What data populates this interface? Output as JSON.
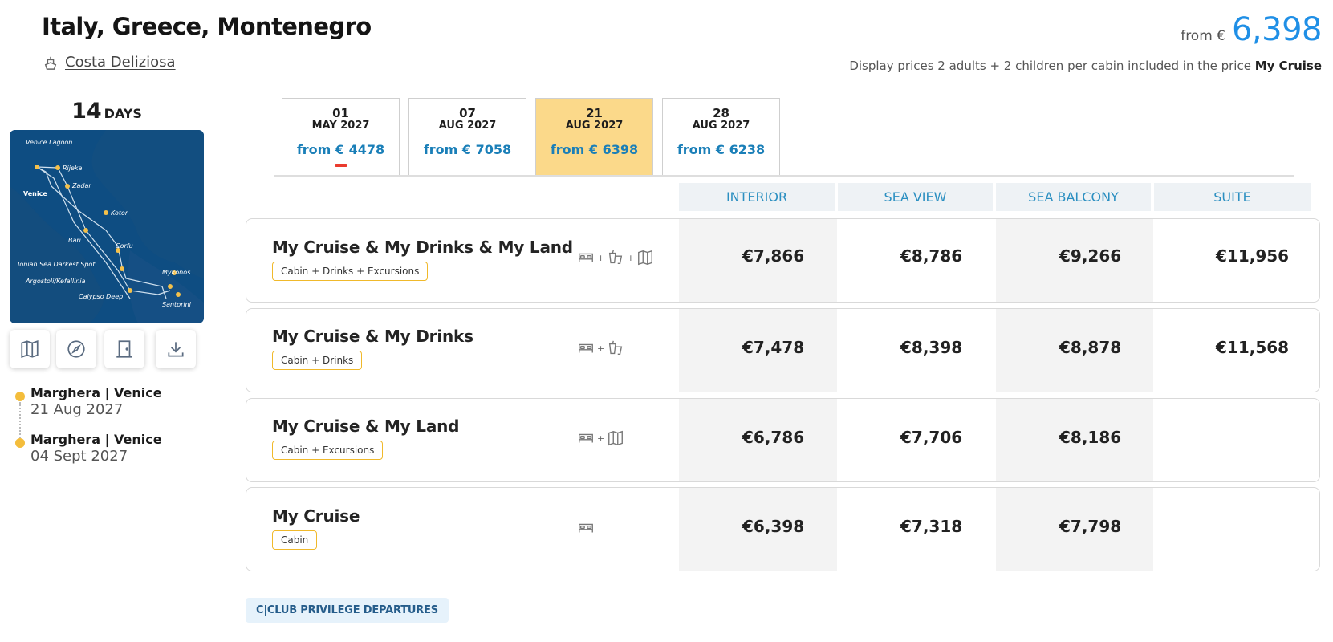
{
  "header": {
    "title": "Italy, Greece, Montenegro",
    "ship_name": "Costa Deliziosa",
    "from_label": "from €",
    "from_price": "6,398",
    "note_prefix": "Display prices 2 adults + 2 children per cabin included in the price",
    "note_product": "My Cruise"
  },
  "itinerary": {
    "days_number": "14",
    "days_label": "DAYS",
    "map_labels": [
      "Venice Lagoon",
      "Venice",
      "Rijeka",
      "Zadar",
      "Kotor",
      "Bari",
      "Corfu",
      "Ionian Sea Darkest Spot",
      "Argostoli/Kefallinia",
      "Calypso Deep",
      "Mykonos",
      "Santorini"
    ],
    "tools": [
      "map-icon",
      "compass-icon",
      "door-icon",
      "download-icon"
    ],
    "departure": {
      "port": "Marghera | Venice",
      "date": "21 Aug 2027"
    },
    "arrival": {
      "port": "Marghera | Venice",
      "date": "04 Sept 2027"
    }
  },
  "date_tabs": [
    {
      "day": "01",
      "month": "MAY 2027",
      "from": "from € 4478"
    },
    {
      "day": "07",
      "month": "AUG 2027",
      "from": "from € 7058"
    },
    {
      "day": "21",
      "month": "AUG 2027",
      "from": "from € 6398"
    },
    {
      "day": "28",
      "month": "AUG 2027",
      "from": "from € 6238"
    }
  ],
  "selected_tab": 2,
  "columns": [
    "INTERIOR",
    "SEA VIEW",
    "SEA BALCONY",
    "SUITE"
  ],
  "packages": [
    {
      "name": "My Cruise & My Drinks & My Land",
      "badge": "Cabin + Drinks + Excursions",
      "icons": [
        "bed-icon",
        "drinks-icon",
        "excursion-map-icon"
      ],
      "prices": [
        "€7,866",
        "€8,786",
        "€9,266",
        "€11,956"
      ]
    },
    {
      "name": "My Cruise & My Drinks",
      "badge": "Cabin + Drinks",
      "icons": [
        "bed-icon",
        "drinks-icon"
      ],
      "prices": [
        "€7,478",
        "€8,398",
        "€8,878",
        "€11,568"
      ]
    },
    {
      "name": "My Cruise & My Land",
      "badge": "Cabin + Excursions",
      "icons": [
        "bed-icon",
        "excursion-map-icon"
      ],
      "prices": [
        "€6,786",
        "€7,706",
        "€8,186",
        ""
      ]
    },
    {
      "name": "My Cruise",
      "badge": "Cabin",
      "icons": [
        "bed-icon"
      ],
      "prices": [
        "€6,398",
        "€7,318",
        "€7,798",
        ""
      ]
    }
  ],
  "club_button": "C|CLUB PRIVILEGE DEPARTURES",
  "colors": {
    "accent_blue": "#1f8fe6",
    "tab_active": "#fbd98a",
    "badge_border": "#f0b92b",
    "marker_red": "#ea3b2e",
    "port_dot": "#f4bd3b"
  }
}
